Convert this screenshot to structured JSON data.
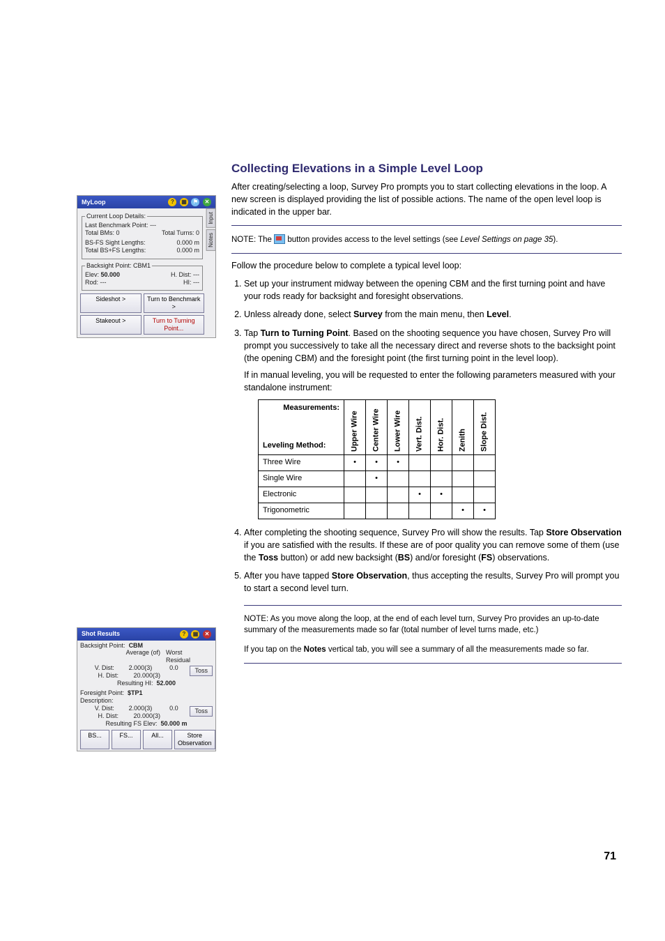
{
  "section": {
    "title": "Collecting Elevations in a Simple Level Loop",
    "intro": "After creating/selecting a loop, Survey Pro prompts you to start collecting elevations in the loop. A new screen is displayed providing the list of possible actions. The name of the open level loop is indicated in the upper bar.",
    "note1_prefix": "NOTE: The ",
    "note1_suffix": " button provides access to the level settings (see ",
    "note1_ref": "Level Settings on page 35",
    "note1_end": ").",
    "follow": "Follow the procedure below to complete a typical level loop:",
    "step1": "Set up your instrument midway between the opening CBM and the first turning point and have your rods ready for backsight and foresight observations.",
    "step2_a": "Unless already done, select ",
    "step2_b": "Survey",
    "step2_c": " from the main menu, then ",
    "step2_d": "Level",
    "step2_e": ".",
    "step3_a": "Tap ",
    "step3_b": "Turn to Turning Point",
    "step3_c": ". Based on the shooting sequence you have chosen, Survey Pro will prompt you successively to take all the necessary direct and reverse shots to the backsight point (the opening CBM) and the foresight point (the first turning point in the level loop).",
    "step3_p2": "If in manual leveling, you will be requested to enter the following parameters measured with your standalone instrument:",
    "step4_a": "After completing the shooting sequence, Survey Pro will show the results. Tap ",
    "step4_b": "Store Observation",
    "step4_c": " if you are satisfied with the results. If these are of poor quality you can remove some of them (use the ",
    "step4_d": "Toss",
    "step4_e": " button) or add new backsight (",
    "step4_f": "BS",
    "step4_g": ") and/or foresight (",
    "step4_h": "FS",
    "step4_i": ") observations.",
    "step5_a": "After you have tapped ",
    "step5_b": "Store Observation",
    "step5_c": ", thus accepting the results, Survey Pro will prompt you to start a second level turn.",
    "note2_p1": "NOTE: As you move along the loop, at the end of each level turn, Survey Pro provides an up-to-date summary of the measurements made so far (total number of level turns made, etc.)",
    "note2_p2a": "If you tap on the ",
    "note2_p2b": "Notes",
    "note2_p2c": " vertical tab, you will see a summary of all the measurements made so far.",
    "pagenum": "71"
  },
  "table": {
    "corner_top": "Measurements:",
    "corner_bottom": "Leveling Method:",
    "cols": [
      "Upper Wire",
      "Center Wire",
      "Lower Wire",
      "Vert. Dist.",
      "Hor. Dist.",
      "Zenith",
      "Slope Dist."
    ],
    "rows": [
      {
        "label": "Three Wire",
        "ticks": [
          "•",
          "•",
          "•",
          "",
          "",
          "",
          ""
        ]
      },
      {
        "label": "Single Wire",
        "ticks": [
          "",
          "•",
          "",
          "",
          "",
          "",
          ""
        ]
      },
      {
        "label": "Electronic",
        "ticks": [
          "",
          "",
          "",
          "•",
          "•",
          "",
          ""
        ]
      },
      {
        "label": "Trigonometric",
        "ticks": [
          "",
          "",
          "",
          "",
          "",
          "•",
          "•"
        ]
      }
    ]
  },
  "scr1": {
    "title": "MyLoop",
    "grp1_legend": "Current Loop Details:",
    "last_bm_lbl": "Last Benchmark Point:",
    "last_bm_val": "---",
    "total_bms_lbl": "Total BMs:",
    "total_bms_val": "0",
    "total_turns_lbl": "Total Turns:",
    "total_turns_val": "0",
    "bsfs_lbl": "BS-FS Sight Lengths:",
    "bsfs_val": "0.000 m",
    "bsfs2_lbl": "Total BS+FS Lengths:",
    "bsfs2_val": "0.000 m",
    "grp2_legend": "Backsight Point: CBM1",
    "elev_lbl": "Elev:",
    "elev_val": "50.000",
    "hdist_lbl": "H. Dist:",
    "hdist_val": "---",
    "rod_lbl": "Rod:",
    "rod_val": "---",
    "hi_lbl": "HI:",
    "hi_val": "---",
    "btn_sideshot": "Sideshot >",
    "btn_turnbm": "Turn to Benchmark >",
    "btn_stakeout": "Stakeout >",
    "btn_turntp": "Turn to Turning Point...",
    "tab_input": "Input",
    "tab_notes": "Notes"
  },
  "scr2": {
    "title": "Shot Results",
    "bs_pt_lbl": "Backsight Point:",
    "bs_pt_val": "CBM",
    "avg_lbl": "Average (of)",
    "resid_lbl": "Worst Residual",
    "vdist_lbl": "V. Dist:",
    "vdist_val": "2.000(3)",
    "vdist_res": "0.0",
    "hdist_lbl": "H. Dist:",
    "hdist_val": "20.000(3)",
    "reshi_lbl": "Resulting HI:",
    "reshi_val": "52.000",
    "fs_pt_lbl": "Foresight Point:",
    "fs_pt_val": "$TP1",
    "desc_lbl": "Description:",
    "v2_val": "2.000(3)",
    "v2_res": "0.0",
    "h2_val": "20.000(3)",
    "resfs_lbl": "Resulting FS Elev:",
    "resfs_val": "50.000 m",
    "btn_bs": "BS...",
    "btn_fs": "FS...",
    "btn_all": "All...",
    "btn_store": "Store Observation",
    "btn_toss": "Toss"
  }
}
